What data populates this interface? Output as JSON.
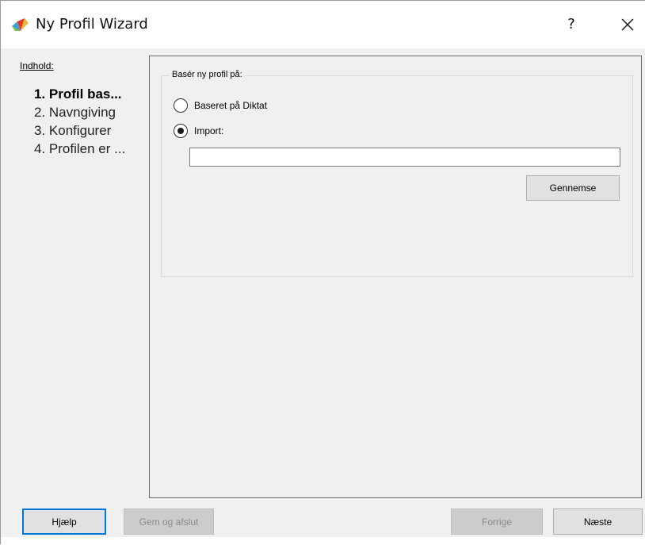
{
  "window": {
    "title": "Ny Profil Wizard",
    "help_glyph": "?",
    "app_icon": "wizard-app-icon",
    "close_icon": "close-icon"
  },
  "sidebar": {
    "heading": "Indhold:",
    "steps": [
      {
        "label": "1. Profil bas...",
        "active": true
      },
      {
        "label": "2. Navngiving",
        "active": false
      },
      {
        "label": "3. Konfigurer",
        "active": false
      },
      {
        "label": "4. Profilen er ...",
        "active": false
      }
    ]
  },
  "group": {
    "legend": "Basér ny profil på:",
    "options": [
      {
        "label": "Baseret på Diktat",
        "checked": false
      },
      {
        "label": "Import:",
        "checked": true
      }
    ],
    "import_path": {
      "value": "",
      "placeholder": ""
    },
    "browse_label": "Gennemse"
  },
  "footer": {
    "help_label": "Hjælp",
    "save_exit_label": "Gem og afslut",
    "back_label": "Forrige",
    "next_label": "Næste"
  },
  "colors": {
    "focus_border": "#0078d7",
    "window_bg": "#f0f0f0",
    "disabled_text": "#8a8a8a"
  }
}
